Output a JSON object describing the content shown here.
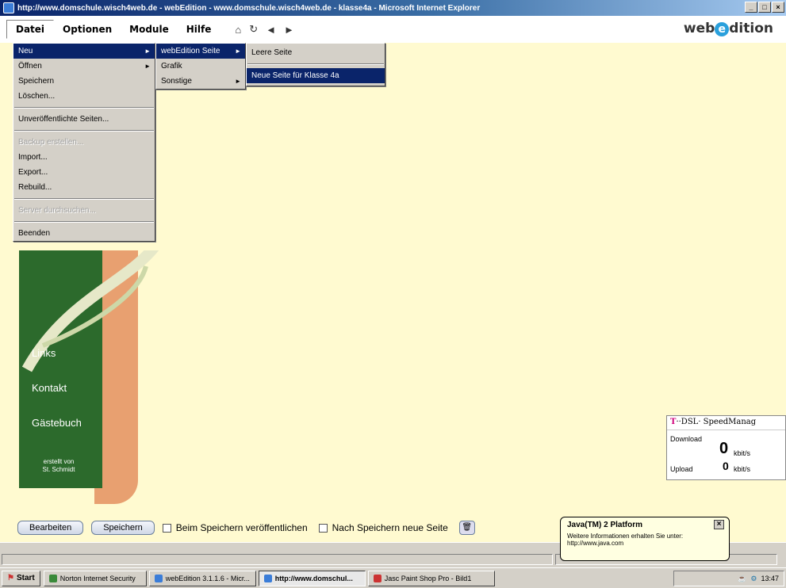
{
  "window": {
    "title": "http://www.domschule.wisch4web.de - webEdition - www.domschule.wisch4web.de - klasse4a - Microsoft Internet Explorer",
    "min_glyph": "_",
    "max_glyph": "□",
    "close_glyph": "×"
  },
  "menubar": {
    "items": [
      "Datei",
      "Optionen",
      "Module",
      "Hilfe"
    ],
    "nav_icons": [
      "⌂",
      "↻",
      "◄",
      "►"
    ],
    "brand_pre": "web",
    "brand_e": "e",
    "brand_post": "dition"
  },
  "file_menu": {
    "items": [
      "Neu",
      "Öffnen",
      "Speichern",
      "Löschen...",
      "Unveröffentlichte Seiten...",
      "Backup erstellen...",
      "Import...",
      "Export...",
      "Rebuild...",
      "Server durchsuchen...",
      "Beenden"
    ]
  },
  "neu_menu": {
    "items": [
      "webEdition Seite",
      "Grafik",
      "Sonstige"
    ]
  },
  "we_menu": {
    "items": [
      "Leere Seite",
      "Neue Seite für Klasse 4a"
    ]
  },
  "sidebar": {
    "links": [
      "Links",
      "Kontakt",
      "Gästebuch"
    ],
    "credit_line1": "erstellt von",
    "credit_line2": "St. Schmidt"
  },
  "dsl": {
    "title_t": "T",
    "title_rest": "··DSL·  SpeedManag",
    "download_label": "Download",
    "upload_label": "Upload",
    "download_value": "0",
    "upload_value": "0",
    "unit": "kbit/s"
  },
  "toolbar": {
    "edit_label": "Bearbeiten",
    "save_label": "Speichern",
    "publish_label": "Beim Speichern veröffentlichen",
    "newpage_label": "Nach Speichern neue Seite"
  },
  "balloon": {
    "title": "Java(TM) 2 Platform",
    "line1": "Weitere Informationen erhalten Sie unter:",
    "line2": "http://www.java.com"
  },
  "taskbar": {
    "start": "Start",
    "tasks": [
      "Norton Internet Security",
      "webEdition 3.1.1.6 - Micr...",
      "http://www.domschul...",
      "Jasc Paint Shop Pro - Bild1"
    ],
    "clock": "13:47"
  },
  "colors": {
    "title_bar": "#0a246a",
    "content_bg": "#fffad0",
    "menu_highlight": "#0a246a",
    "sidebar_green": "#2c6a2c",
    "sidebar_orange": "#e8a070",
    "brand_e": "#2aa0dc"
  }
}
